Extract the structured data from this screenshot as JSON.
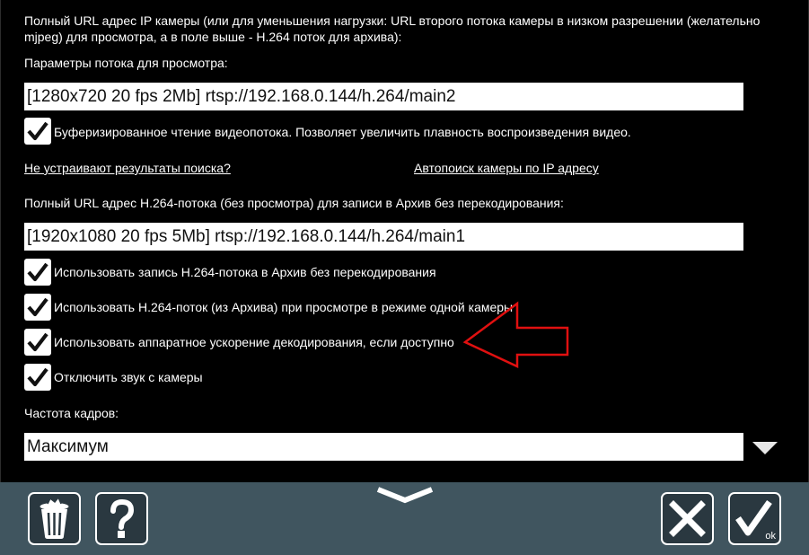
{
  "main_url": {
    "description": "Полный URL адрес IP камеры (или для уменьшения нагрузки: URL второго потока камеры в низком разрешении (желательно mjpeg) для просмотра, а в поле выше - H.264 поток для архива):",
    "params_label": "Параметры потока для просмотра:",
    "value": "[1280x720 20 fps 2Mb] rtsp://192.168.0.144/h.264/main2"
  },
  "buffered_reading": {
    "checked": true,
    "label": "Буферизированное чтение видеопотока. Позволяет увеличить плавность воспроизведения видео."
  },
  "links": {
    "search_results": "Не устраивают результаты поиска?",
    "autodetect": "Автопоиск камеры по IP адресу"
  },
  "h264_url": {
    "label": "Полный URL адрес H.264-потока (без просмотра) для записи в Архив без перекодирования:",
    "value": "[1920x1080 20 fps 5Mb] rtsp://192.168.0.144/h.264/main1"
  },
  "options": [
    {
      "checked": true,
      "label": "Использовать запись H.264-потока в Архив без перекодирования"
    },
    {
      "checked": true,
      "label": "Использовать H.264-поток (из Архива) при просмотре в режиме одной камеры"
    },
    {
      "checked": true,
      "label": "Использовать аппаратное ускорение декодирования, если доступно"
    },
    {
      "checked": true,
      "label": "Отключить звук с камеры"
    }
  ],
  "frame_rate": {
    "label": "Частота кадров:",
    "value": "Максимум"
  },
  "toolbar": {
    "ok_label": "ok"
  },
  "icons": {
    "delete": "trash-icon",
    "help": "question-icon",
    "cancel": "close-icon",
    "confirm": "checkmark-icon",
    "collapse": "chevron-down-icon",
    "dropdown": "triangle-down-icon"
  },
  "colors": {
    "background": "#000000",
    "bottom_bar": "#40555f",
    "button_fill": "#2a3840",
    "annotation": "#e01010"
  }
}
